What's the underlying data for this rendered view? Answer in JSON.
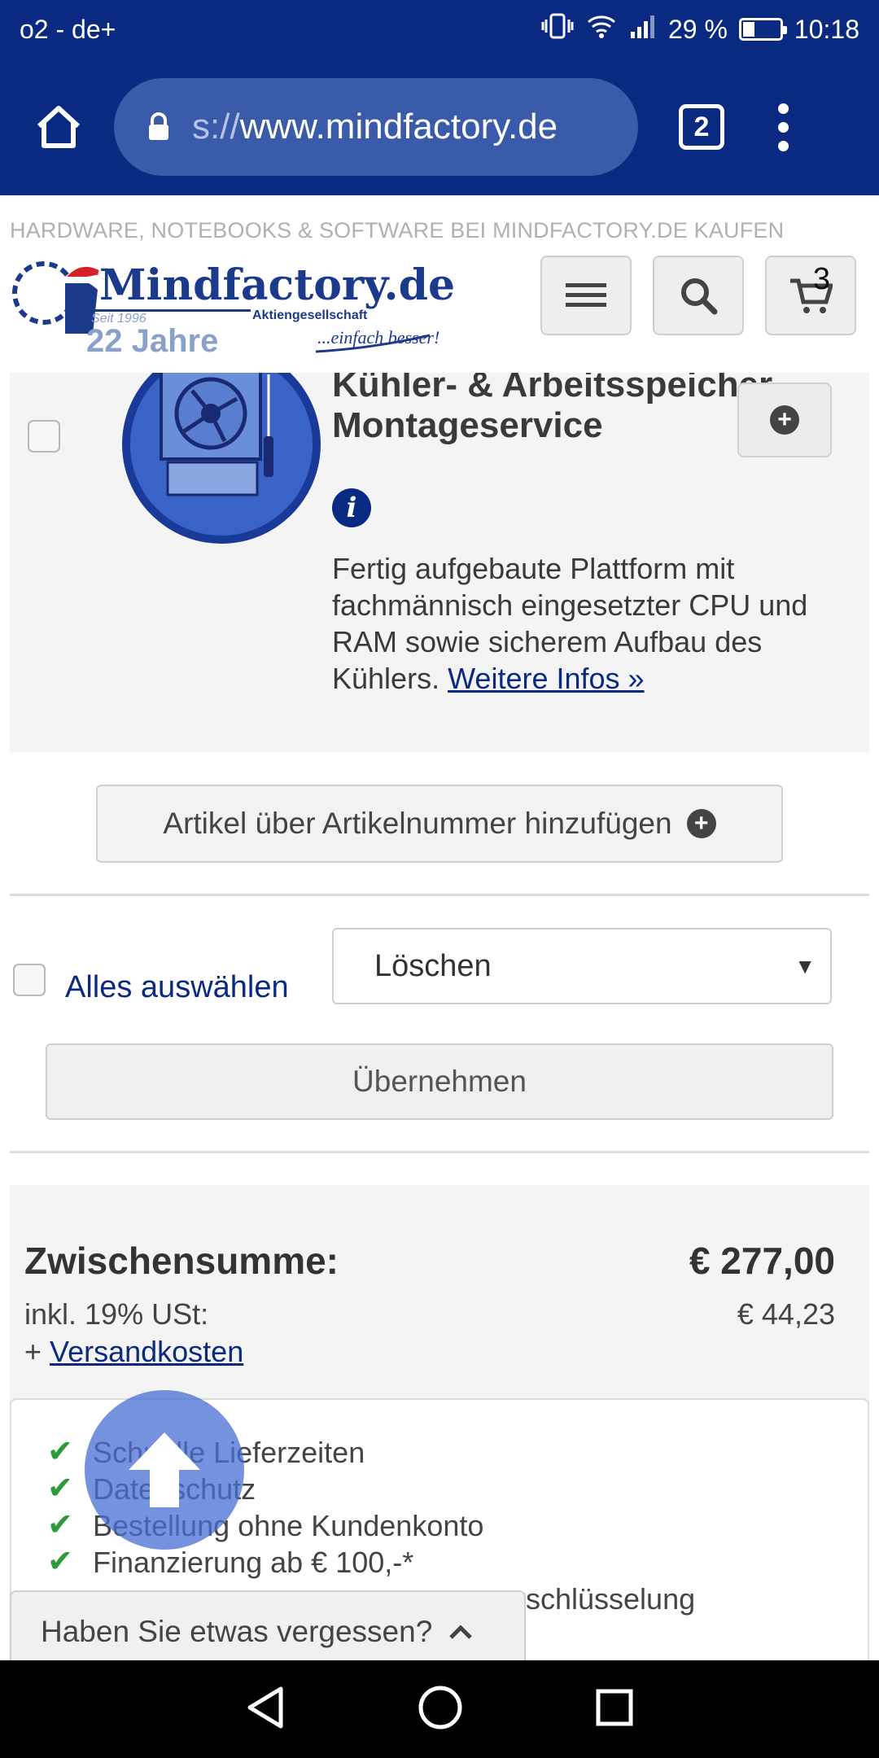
{
  "status_bar": {
    "carrier": "o2 - de+",
    "battery_text": "29 %",
    "battery_level": 0.29,
    "time": "10:18"
  },
  "browser": {
    "url_scheme": "s://",
    "url_host": "www.mindfactory.de",
    "tab_count": "2"
  },
  "site": {
    "tagline": "HARDWARE, NOTEBOOKS & SOFTWARE BEI MINDFACTORY.DE KAUFEN",
    "logo": {
      "name": "Mindfactory.de",
      "subtitle": "Aktiengesellschaft",
      "since": "Seit 1996",
      "years": "22 Jahre",
      "slogan": "...einfach besser!"
    },
    "cart_count": "3"
  },
  "service": {
    "title": "Kühler- & Arbeitsspeicher-Montageservice",
    "description": "Fertig aufgebaute Plattform mit fachmännisch eingesetzter CPU und RAM sowie sicherem Aufbau des Kühlers.",
    "more_link": "Weitere Infos »"
  },
  "actions": {
    "add_by_number": "Artikel über Artikelnummer hinzufügen",
    "select_all": "Alles auswählen",
    "bulk_action_selected": "Löschen",
    "apply": "Übernehmen"
  },
  "summary": {
    "subtotal_label": "Zwischensumme:",
    "subtotal_value": "€ 277,00",
    "vat_label": "inkl. 19% USt:",
    "vat_value": "€ 44,23",
    "shipping_prefix": "+",
    "shipping_link": "Versandkosten"
  },
  "features": [
    "Schnelle Lieferzeiten",
    "Datenschutz",
    "Bestellung ohne Kundenkonto",
    "Finanzierung ab € 100,-*",
    "rschlüsselung"
  ],
  "forgot_tab": "Haben Sie etwas vergessen?",
  "colors": {
    "brand_blue": "#0a2a82",
    "check_green": "#2e9a3a"
  }
}
